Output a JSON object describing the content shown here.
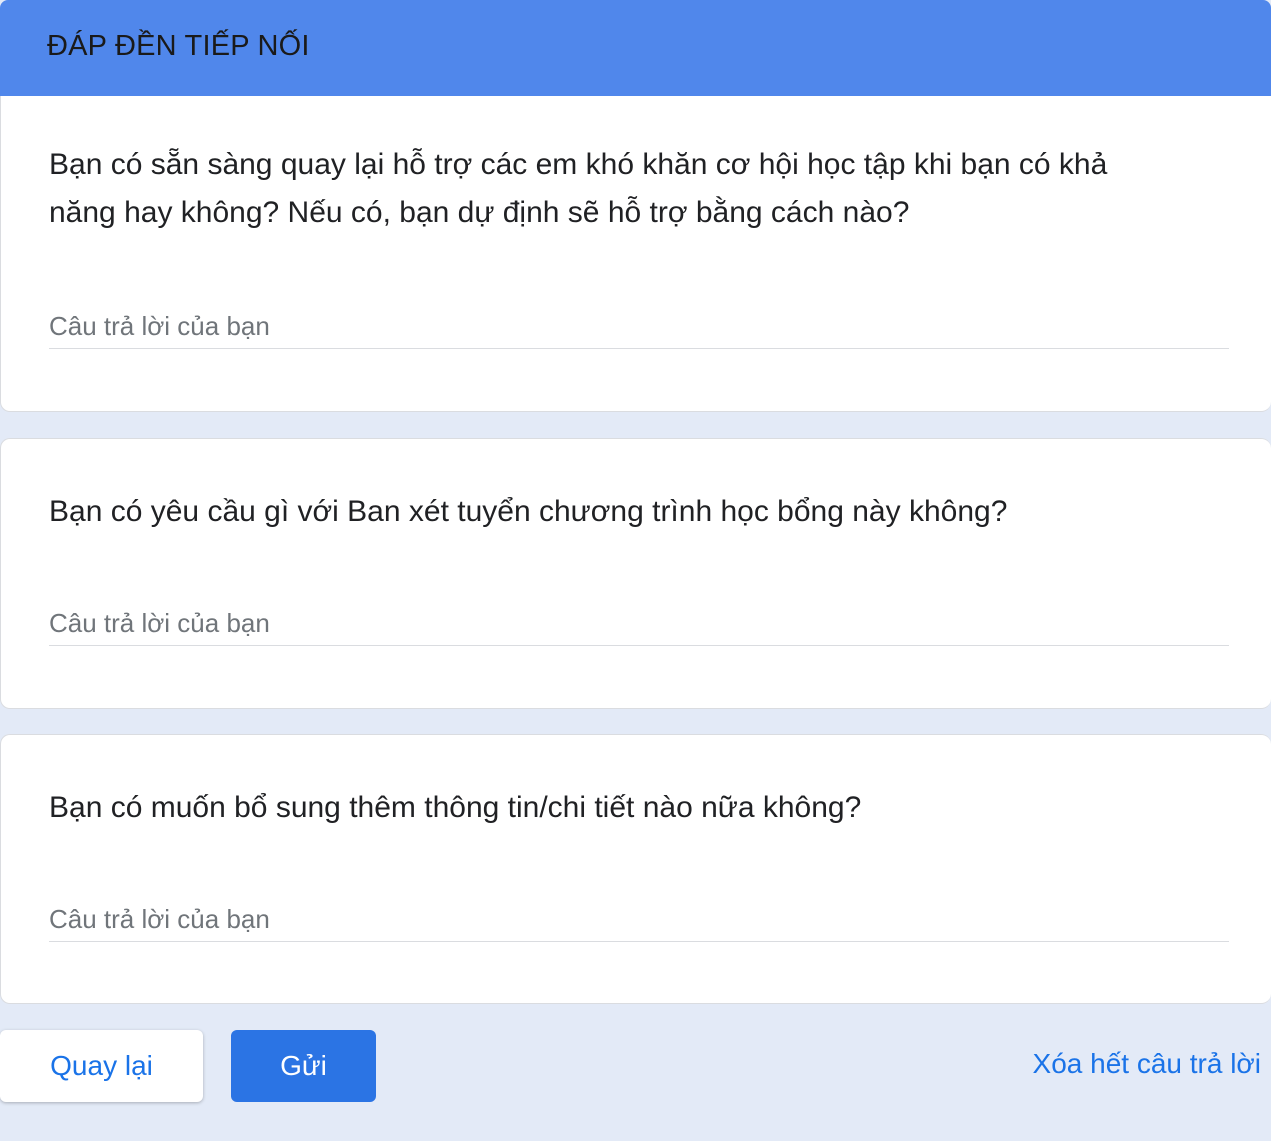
{
  "section": {
    "title": "ĐÁP ĐỀN TIẾP NỐI"
  },
  "questions": [
    {
      "text": "Bạn có sẵn sàng quay lại hỗ trợ các em khó khăn cơ hội học tập khi bạn có khả năng hay không? Nếu có, bạn dự định sẽ hỗ trợ bằng cách nào?",
      "placeholder": "Câu trả lời của bạn",
      "value": ""
    },
    {
      "text": "Bạn có yêu cầu gì với Ban xét tuyển chương trình học bổng này không?",
      "placeholder": "Câu trả lời của bạn",
      "value": ""
    },
    {
      "text": "Bạn có muốn bổ sung thêm thông tin/chi tiết nào nữa không?",
      "placeholder": "Câu trả lời của bạn",
      "value": ""
    }
  ],
  "actions": {
    "back_label": "Quay lại",
    "submit_label": "Gửi",
    "clear_label": "Xóa hết câu trả lời"
  },
  "colors": {
    "header": "#5087eb",
    "accent": "#1a73e8",
    "submit": "#2b74e4",
    "background": "#e3eaf7"
  }
}
